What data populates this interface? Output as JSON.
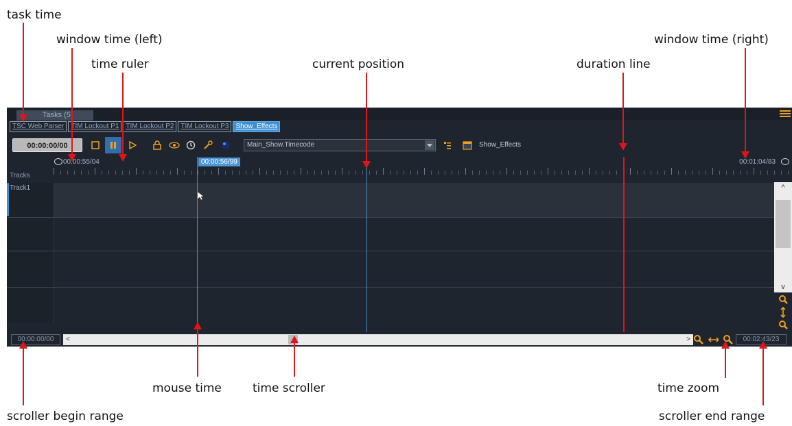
{
  "annotations": {
    "task_time": "task time",
    "window_time_left": "window time (left)",
    "time_ruler": "time ruler",
    "current_position": "current position",
    "duration_line": "duration line",
    "window_time_right": "window time (right)",
    "mouse_time": "mouse time",
    "time_scroller": "time scroller",
    "time_zoom": "time zoom",
    "scroller_begin_range": "scroller begin range",
    "scroller_end_range": "scroller end range"
  },
  "app": {
    "tasks_tab": "Tasks (5)",
    "task_list": [
      {
        "label": "TSC Web Parser",
        "active": false
      },
      {
        "label": "TIM Lockout P1",
        "active": false
      },
      {
        "label": "TIM Lockout P2",
        "active": false
      },
      {
        "label": "TIM Lockout P3",
        "active": false
      },
      {
        "label": "Show_Effects",
        "active": true
      }
    ],
    "toolbar": {
      "task_time": "00:00:00/00",
      "timecode_source": "Main_Show.Timecode",
      "show_effects_label": "Show_Effects"
    },
    "ruler": {
      "window_time_left": "00:00:55/04",
      "mouse_time": "00:00:56/99",
      "window_time_right": "00:01:04/83"
    },
    "tracks_header": "Tracks",
    "tracks": [
      "Track1"
    ],
    "bottom": {
      "scroller_begin": "00:00:00/00",
      "scroller_end": "00:02:43/23"
    },
    "colors": {
      "accent_orange": "#f0a020",
      "active_blue": "#3c8fd4",
      "duration_line": "#e0151b",
      "current_position": "#4a8fd0",
      "mouse_line": "#c0664a"
    }
  }
}
